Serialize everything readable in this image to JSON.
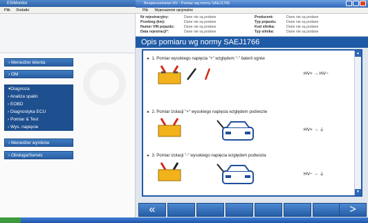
{
  "left_app": {
    "title": "ESIMonitor",
    "menu": [
      "Plik",
      "Dodatki"
    ],
    "nav": [
      {
        "label": "Menedżer klienta",
        "open": false
      },
      {
        "label": "OM",
        "open": false
      },
      {
        "label": "Diagnoza",
        "open": true,
        "children": [
          "Analiza spalin",
          "EOBD",
          "Diagnostyka ECU",
          "Pomiar & Test",
          "Wys. napięcie"
        ]
      },
      {
        "label": "Menedżer wyników",
        "open": false
      },
      {
        "label": "Obsługa/Serwis",
        "open": false
      }
    ]
  },
  "window": {
    "title": "Bezpieczeństwo HV - Pomiar wg normy SAEJ1766",
    "menu": [
      "Plik",
      "Wyposażenie opcjonalne"
    ],
    "info": {
      "left": [
        {
          "key": "Nr rejestracyjny:",
          "value": "Dane nie są podane"
        },
        {
          "key": "Przebieg (km):",
          "value": "Dane nie są podane"
        },
        {
          "key": "Numer VIN pojazdu:",
          "value": "Dane nie są podane"
        },
        {
          "key": "Data rejestracji*:",
          "value": "Dane nie są podane"
        }
      ],
      "right": [
        {
          "key": "Producent:",
          "value": "Dane nie są podane"
        },
        {
          "key": "Typ pojazdu:",
          "value": "Dane nie są podane"
        },
        {
          "key": "Kod silnika:",
          "value": "Dane nie są podane"
        },
        {
          "key": "Typ silnika:",
          "value": "Dane nie są podane"
        }
      ]
    },
    "heading": "Opis pomiaru wg normy SAEJ1766",
    "steps": [
      {
        "text": "1. Pomiar wysokiego napięcia \"+\" względem \"-\" baterii ogniw",
        "formula": "HV+ → HV−"
      },
      {
        "text": "2. Pomiar izolacji \"+\" wysokiego napięcia względem podwozie",
        "formula": "HV+ → ⏚"
      },
      {
        "text": "3. Pomiar izolacji \"-\" wysokiego napięcia względem podwozia",
        "formula": "HV− → ⏚"
      }
    ],
    "footer": {
      "back": "«",
      "next": ">"
    }
  },
  "colors": {
    "accent": "#1f5aa6",
    "battery": "#f2b21b",
    "clip_red": "#d12a1a"
  },
  "icons": [
    "battery-icon",
    "car-front-icon",
    "probe-icon",
    "back-icon",
    "next-icon"
  ]
}
